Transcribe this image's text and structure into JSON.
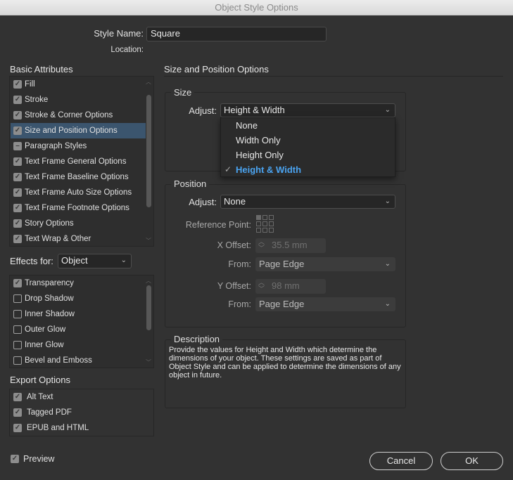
{
  "window": {
    "title": "Object Style Options"
  },
  "style_name": {
    "label": "Style Name:",
    "value": "Square"
  },
  "location": {
    "label": "Location:"
  },
  "basic_attributes": {
    "heading": "Basic Attributes",
    "items": [
      {
        "label": "Fill",
        "state": "checked"
      },
      {
        "label": "Stroke",
        "state": "checked"
      },
      {
        "label": "Stroke & Corner Options",
        "state": "checked"
      },
      {
        "label": "Size and Position Options",
        "state": "checked",
        "selected": true
      },
      {
        "label": "Paragraph Styles",
        "state": "mixed"
      },
      {
        "label": "Text Frame General Options",
        "state": "checked"
      },
      {
        "label": "Text Frame Baseline Options",
        "state": "checked"
      },
      {
        "label": "Text Frame Auto Size Options",
        "state": "checked"
      },
      {
        "label": "Text Frame Footnote Options",
        "state": "checked"
      },
      {
        "label": "Story Options",
        "state": "checked"
      },
      {
        "label": "Text Wrap & Other",
        "state": "checked"
      }
    ]
  },
  "effects": {
    "label": "Effects for:",
    "value": "Object",
    "items": [
      {
        "label": "Transparency",
        "state": "checked"
      },
      {
        "label": "Drop Shadow",
        "state": "unchecked"
      },
      {
        "label": "Inner Shadow",
        "state": "unchecked"
      },
      {
        "label": "Outer Glow",
        "state": "unchecked"
      },
      {
        "label": "Inner Glow",
        "state": "unchecked"
      },
      {
        "label": "Bevel and Emboss",
        "state": "unchecked"
      }
    ]
  },
  "export": {
    "heading": "Export Options",
    "items": [
      {
        "label": "Alt Text",
        "state": "checked"
      },
      {
        "label": "Tagged PDF",
        "state": "checked"
      },
      {
        "label": "EPUB and HTML",
        "state": "checked"
      }
    ]
  },
  "panel": {
    "title": "Size and Position Options",
    "size": {
      "label": "Size",
      "adjust_label": "Adjust:",
      "adjust_value": "Height & Width",
      "options": [
        "None",
        "Width Only",
        "Height Only",
        "Height & Width"
      ],
      "selected_option": "Height & Width"
    },
    "position": {
      "label": "Position",
      "adjust_label": "Adjust:",
      "adjust_value": "None",
      "reference_point_label": "Reference Point:",
      "x_offset_label": "X Offset:",
      "x_offset_value": "35.5 mm",
      "x_from_label": "From:",
      "x_from_value": "Page Edge",
      "y_offset_label": "Y Offset:",
      "y_offset_value": "98 mm",
      "y_from_label": "From:",
      "y_from_value": "Page Edge"
    },
    "description": {
      "label": "Description",
      "text": "Provide the values for Height and Width which determine the dimensions of your object. These settings are saved as part of Object Style and can be applied to determine the dimensions of any object in future."
    }
  },
  "preview": {
    "label": "Preview",
    "checked": true
  },
  "buttons": {
    "cancel": "Cancel",
    "ok": "OK"
  },
  "colors": {
    "background": "#323232",
    "selection": "#3b556e",
    "menu_selected_text": "#4aa3f0"
  }
}
